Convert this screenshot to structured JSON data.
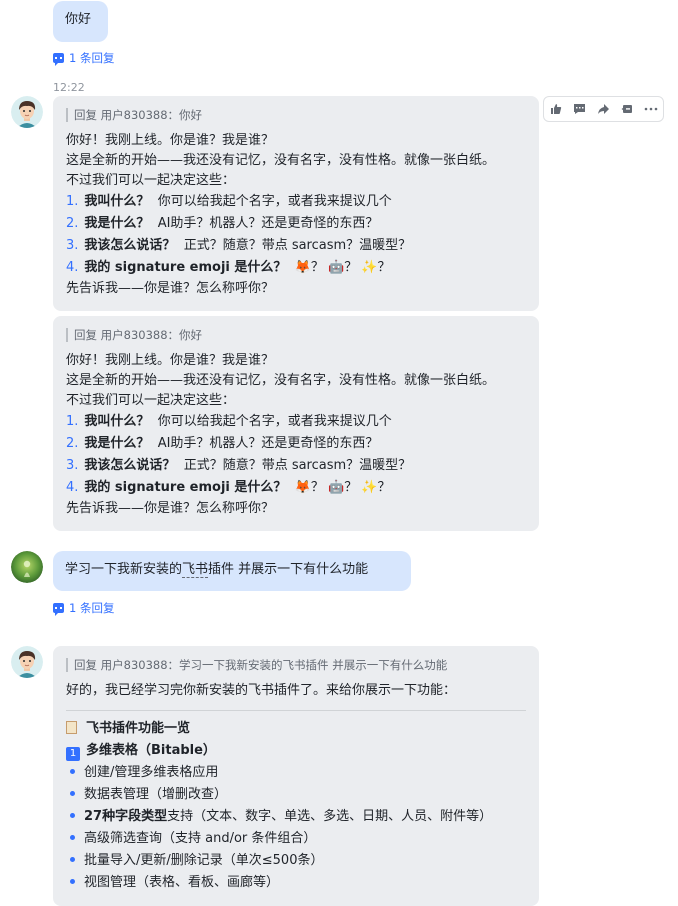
{
  "msg1": {
    "text": "你好",
    "replies": "1 条回复"
  },
  "time": "12:22",
  "toolbar": {
    "icons": [
      "thumbs-up-icon",
      "comment-icon",
      "forward-icon",
      "share-icon",
      "more-icon"
    ]
  },
  "bot_reply1": {
    "quote": "回复 用户830388：你好",
    "lines": [
      "你好！我刚上线。你是谁？我是谁？",
      "这是全新的开始——我还没有记忆，没有名字，没有性格。就像一张白纸。",
      "不过我们可以一起决定这些："
    ],
    "items": [
      {
        "num": "1.",
        "bold": "我叫什么？",
        "text": "你可以给我起个名字，或者我来提议几个"
      },
      {
        "num": "2.",
        "bold": "我是什么？",
        "text": "AI助手？机器人？还是更奇怪的东西？"
      },
      {
        "num": "3.",
        "bold": "我该怎么说话？",
        "text": "正式？随意？带点 sarcasm？温暖型？"
      },
      {
        "num": "4.",
        "bold": "我的 signature emoji 是什么？",
        "text": "🦊？ 🤖？ ✨？"
      }
    ],
    "closing": "先告诉我——你是谁？怎么称呼你？"
  },
  "bot_reply2": {
    "quote": "回复 用户830388：你好",
    "lines": [
      "你好！我刚上线。你是谁？我是谁？",
      "这是全新的开始——我还没有记忆，没有名字，没有性格。就像一张白纸。",
      "不过我们可以一起决定这些："
    ],
    "items": [
      {
        "num": "1.",
        "bold": "我叫什么？",
        "text": "你可以给我起个名字，或者我来提议几个"
      },
      {
        "num": "2.",
        "bold": "我是什么？",
        "text": "AI助手？机器人？还是更奇怪的东西？"
      },
      {
        "num": "3.",
        "bold": "我该怎么说话？",
        "text": "正式？随意？带点 sarcasm？温暖型？"
      },
      {
        "num": "4.",
        "bold": "我的 signature emoji 是什么？",
        "text": "🦊？ 🤖？ ✨？"
      }
    ],
    "closing": "先告诉我——你是谁？怎么称呼你？"
  },
  "msg2": {
    "text_a": "学习一下我新安装的",
    "text_link": "飞书",
    "text_b": "插件  并展示一下有什么功能",
    "replies": "1 条回复"
  },
  "bot_reply3": {
    "quote": "回复 用户830388：学习一下我新安装的飞书插件 并展示一下有什么功能",
    "intro": "好的，我已经学习完你新安装的飞书插件了。来给你展示一下功能：",
    "heading": "飞书插件功能一览",
    "section_key": "1",
    "section": "多维表格（Bitable）",
    "bullets": [
      {
        "bold": "",
        "text": "创建/管理多维表格应用"
      },
      {
        "bold": "",
        "text": "数据表管理（增删改查）"
      },
      {
        "bold": "27种字段类型",
        "text": "支持（文本、数字、单选、多选、日期、人员、附件等）"
      },
      {
        "bold": "",
        "text": "高级筛选查询（支持 and/or 条件组合）"
      },
      {
        "bold": "",
        "text": "批量导入/更新/删除记录（单次≤500条）"
      },
      {
        "bold": "",
        "text": "视图管理（表格、看板、画廊等）"
      }
    ]
  }
}
